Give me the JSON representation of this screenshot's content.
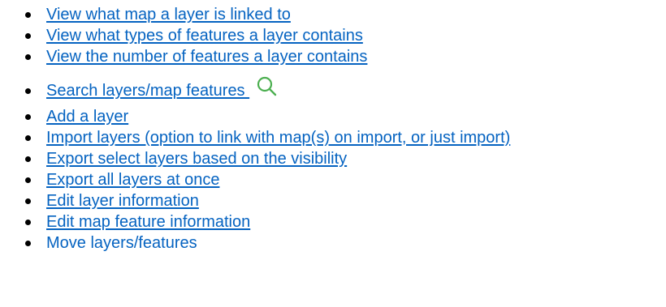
{
  "items": [
    {
      "label": "View what map a layer is linked to"
    },
    {
      "label": "View what types of features a layer contains"
    },
    {
      "label": "View the number of features a layer contains"
    },
    {
      "label": "Search layers/map features ",
      "icon": "search-icon",
      "icon_color": "#4caf50"
    },
    {
      "label": "Add a layer"
    },
    {
      "label": "Import layers (option to link with map(s) on import, or just import)"
    },
    {
      "label": "Export select layers based on the visibility"
    },
    {
      "label": "Export all layers at once"
    },
    {
      "label": "Edit layer information"
    },
    {
      "label": "Edit map feature information"
    },
    {
      "label": "Move layers/features"
    }
  ],
  "colors": {
    "link": "#0563c1",
    "bullet": "#000000"
  }
}
